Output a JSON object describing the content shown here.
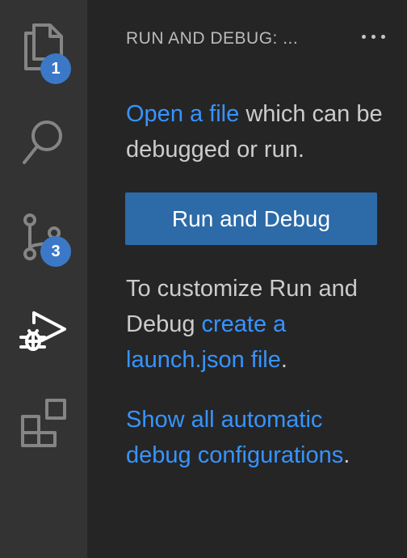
{
  "activity_bar": {
    "items": [
      {
        "icon": "files-icon",
        "badge": "1"
      },
      {
        "icon": "search-icon",
        "badge": ""
      },
      {
        "icon": "source-control-icon",
        "badge": "3"
      },
      {
        "icon": "run-debug-icon",
        "badge": ""
      },
      {
        "icon": "extensions-icon",
        "badge": ""
      }
    ]
  },
  "sidebar": {
    "title": "RUN AND DEBUG: ...",
    "open_file_link": "Open a file",
    "open_file_rest": " which can be debugged or run.",
    "run_button_label": "Run and Debug",
    "customize_prefix": "To customize Run and Debug ",
    "create_launch_link": "create a launch.json file",
    "customize_suffix": ".",
    "show_all_link": "Show all automatic debug configurations",
    "show_all_suffix": "."
  },
  "colors": {
    "activity_bar_bg": "#333333",
    "sidebar_bg": "#252526",
    "link": "#3794ff",
    "button_bg": "#2d6aa8",
    "badge_bg": "#3c78c8",
    "text": "#cccccc"
  }
}
